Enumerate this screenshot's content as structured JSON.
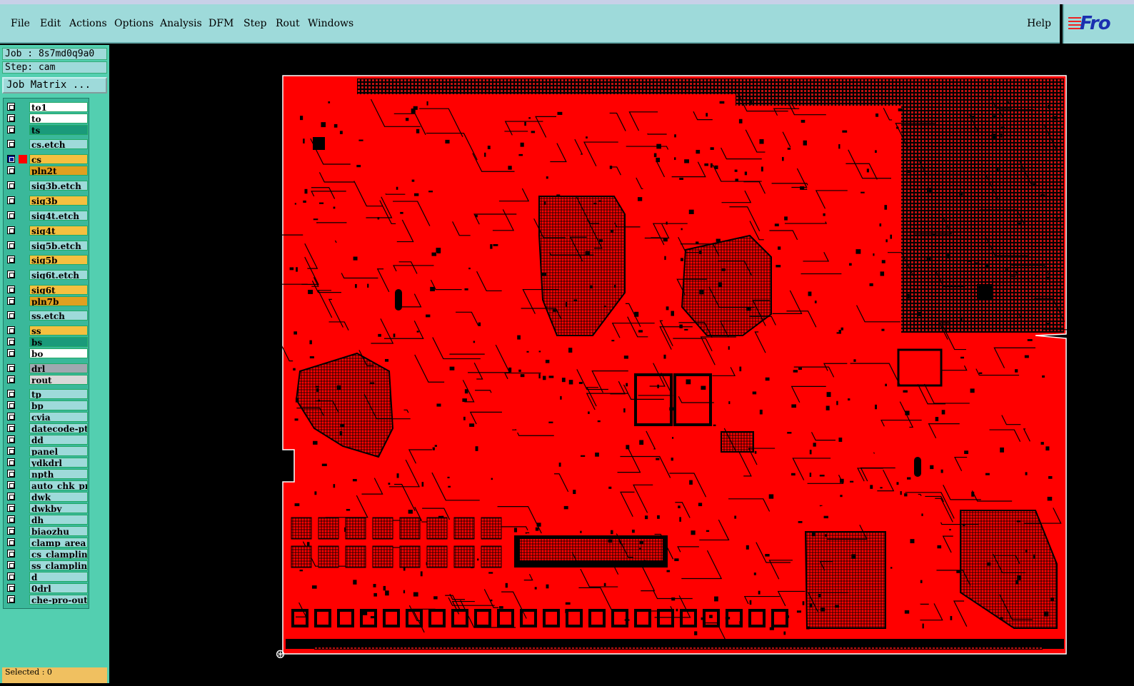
{
  "menubar": {
    "items": [
      "File",
      "Edit",
      "Actions",
      "Options",
      "Analysis",
      "DFM",
      "Step",
      "Rout",
      "Windows"
    ],
    "help": "Help"
  },
  "logo": {
    "text": "Fro"
  },
  "job_info": {
    "job": "Job : 8s7md0q9a0",
    "step": "Step: cam"
  },
  "job_matrix_button": "Job Matrix ...",
  "layers": [
    {
      "name": "to1",
      "color": "#ffffff"
    },
    {
      "name": "to",
      "color": "#ffffff"
    },
    {
      "name": "ts",
      "color": "#1a9a7a"
    },
    {
      "name": "cs.etch",
      "color": "#9edada"
    },
    {
      "name": "cs",
      "color": "#f5c040",
      "active": true
    },
    {
      "name": "pln2t",
      "color": "#e0a020"
    },
    {
      "name": "sig3b.etch",
      "color": "#9edada"
    },
    {
      "name": "sig3b",
      "color": "#f5c040"
    },
    {
      "name": "sig4t.etch",
      "color": "#9edada"
    },
    {
      "name": "sig4t",
      "color": "#f5c040"
    },
    {
      "name": "sig5b.etch",
      "color": "#9edada"
    },
    {
      "name": "sig5b",
      "color": "#f5c040"
    },
    {
      "name": "sig6t.etch",
      "color": "#9edada"
    },
    {
      "name": "sig6t",
      "color": "#f5c040"
    },
    {
      "name": "pln7b",
      "color": "#e0a020"
    },
    {
      "name": "ss.etch",
      "color": "#9edada"
    },
    {
      "name": "ss",
      "color": "#f5c040"
    },
    {
      "name": "bs",
      "color": "#1a9a7a"
    },
    {
      "name": "bo",
      "color": "#ffffff"
    },
    {
      "name": "drl",
      "color": "#a0a8b0"
    },
    {
      "name": "rout",
      "color": "#d8d8d8"
    },
    {
      "name": "tp",
      "color": "#9edada"
    },
    {
      "name": "bp",
      "color": "#9edada"
    },
    {
      "name": "cvia",
      "color": "#9edada"
    },
    {
      "name": "datecode-pto",
      "color": "#9edada"
    },
    {
      "name": "dd",
      "color": "#9edada"
    },
    {
      "name": "panel",
      "color": "#9edada"
    },
    {
      "name": "ydkdrl",
      "color": "#9edada"
    },
    {
      "name": "npth",
      "color": "#9edada"
    },
    {
      "name": "auto_chk_pnl",
      "color": "#9edada"
    },
    {
      "name": "dwk",
      "color": "#9edada"
    },
    {
      "name": "dwkby",
      "color": "#9edada"
    },
    {
      "name": "dh",
      "color": "#9edada"
    },
    {
      "name": "biaozhu",
      "color": "#9edada"
    },
    {
      "name": "clamp_area",
      "color": "#9edada"
    },
    {
      "name": "cs_clampline",
      "color": "#9edada"
    },
    {
      "name": "ss_clampline",
      "color": "#9edada"
    },
    {
      "name": "d",
      "color": "#9edada"
    },
    {
      "name": "0drl",
      "color": "#9edada"
    },
    {
      "name": "che-pro-out",
      "color": "#9edada"
    }
  ],
  "status": {
    "selected": "Selected : 0"
  },
  "colors": {
    "board": "#ff0000",
    "trace": "#000000",
    "background": "#000000"
  }
}
